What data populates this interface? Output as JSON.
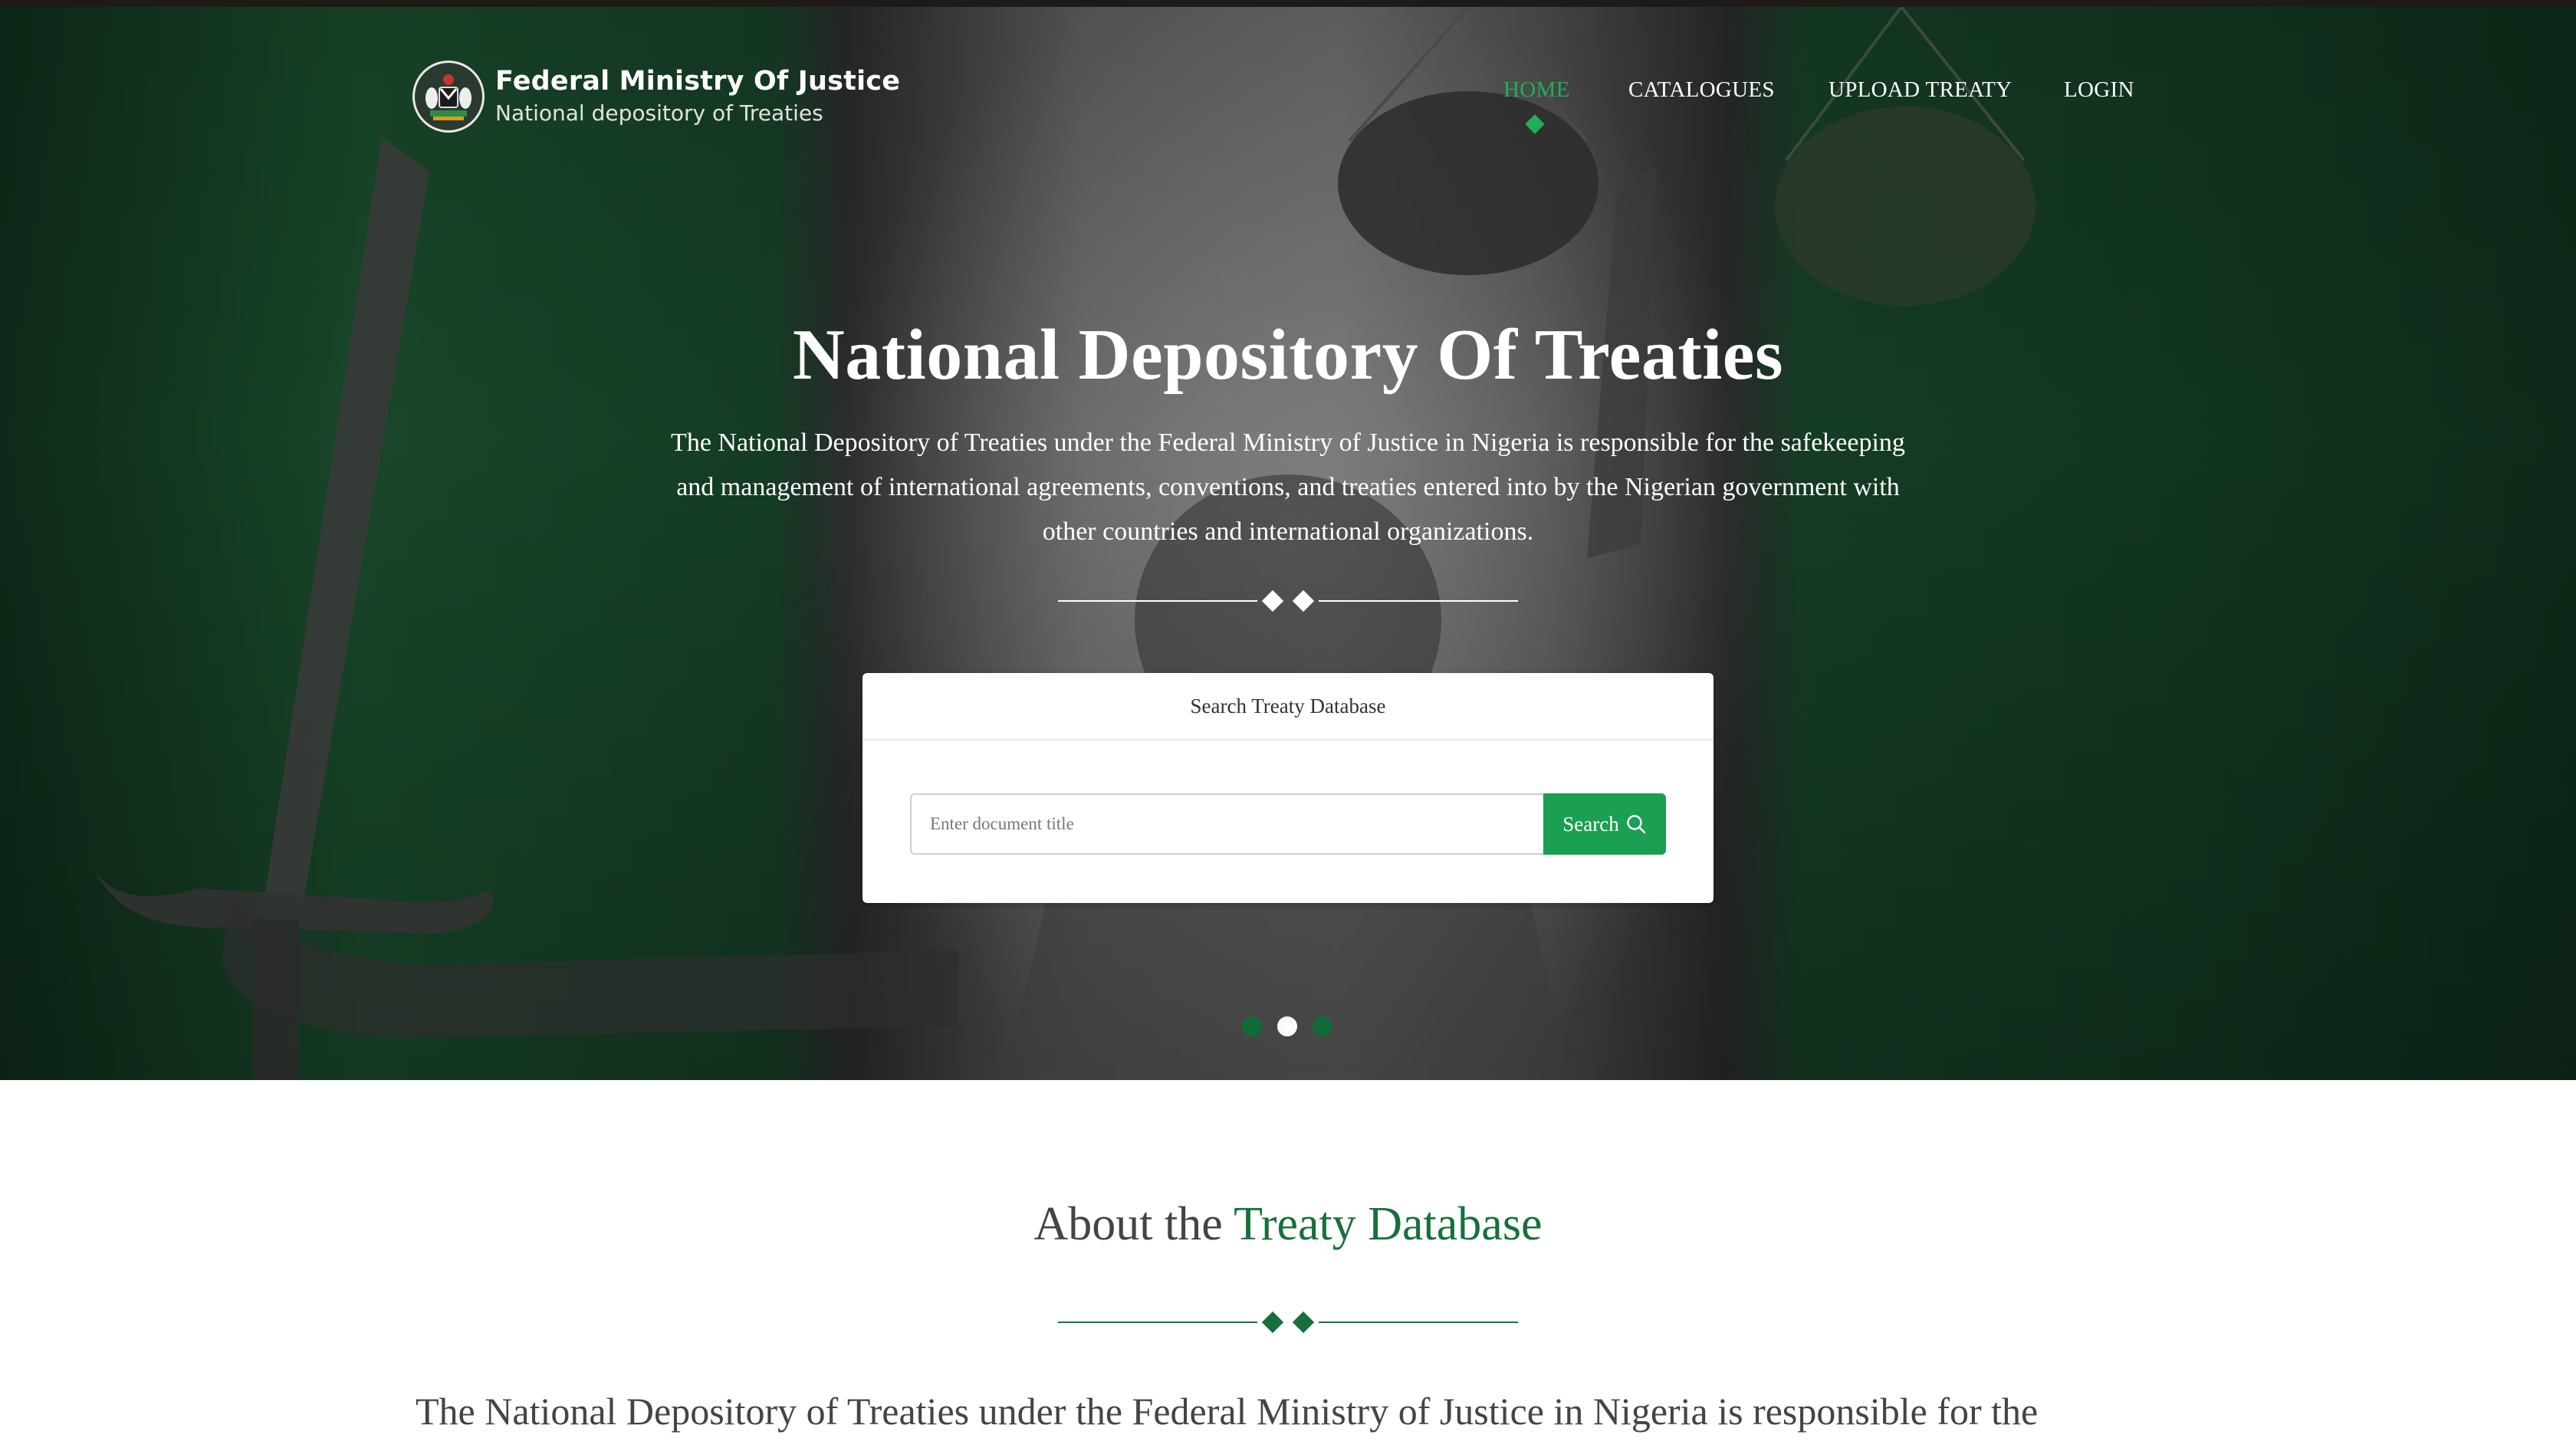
{
  "header": {
    "brand_title": "Federal Ministry Of Justice",
    "brand_subtitle": "National depository of Treaties",
    "nav": [
      {
        "label": "HOME",
        "active": true
      },
      {
        "label": "CATALOGUES",
        "active": false
      },
      {
        "label": "UPLOAD TREATY",
        "active": false
      },
      {
        "label": "LOGIN",
        "active": false
      }
    ]
  },
  "hero": {
    "title": "National Depository Of Treaties",
    "description": "The National Depository of Treaties under the Federal Ministry of Justice in Nigeria is responsible for the safekeeping and management of international agreements, conventions, and treaties entered into by the Nigerian government with other countries and international organizations.",
    "search": {
      "header": "Search Treaty Database",
      "placeholder": "Enter document title",
      "button_label": "Search",
      "button_icon": "search-icon"
    },
    "slides": {
      "count": 3,
      "active_index": 1
    }
  },
  "about": {
    "title_prefix": "About the",
    "title_accent": "Treaty Database",
    "text": "The National Depository of Treaties under the Federal Ministry of Justice in Nigeria is responsible for the"
  },
  "colors": {
    "accent_green": "#1fae5a",
    "button_green": "#1a9f53",
    "dark_green": "#17703c"
  }
}
